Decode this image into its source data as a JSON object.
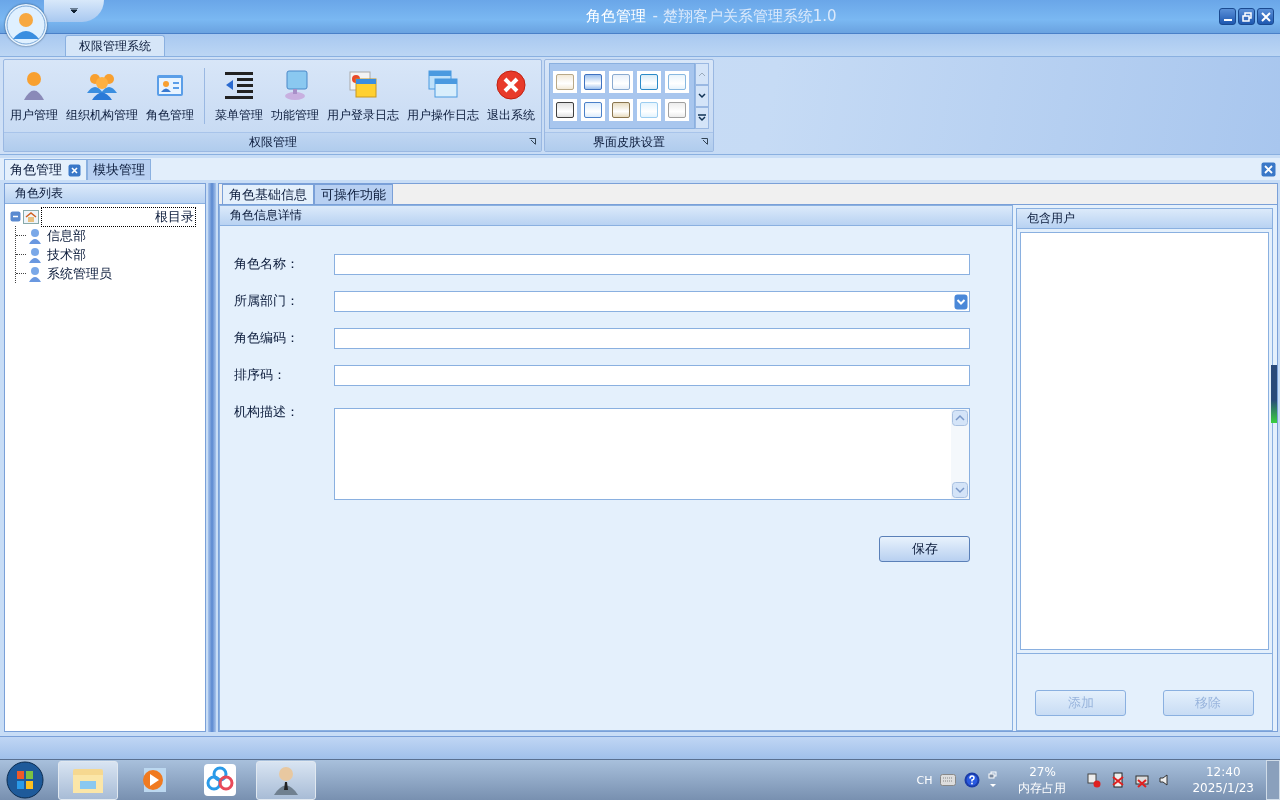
{
  "window": {
    "title": "角色管理",
    "subtitle": "- 楚翔客户关系管理系统1.0"
  },
  "ribbon": {
    "tabs": [
      {
        "label": "权限管理系统",
        "selected": true
      }
    ],
    "group": {
      "title": "权限管理",
      "buttons": [
        {
          "label": "用户管理",
          "kind": "user"
        },
        {
          "label": "组织机构管理",
          "kind": "org"
        },
        {
          "label": "角色管理",
          "kind": "role"
        },
        {
          "label": "菜单管理",
          "kind": "menu"
        },
        {
          "label": "功能管理",
          "kind": "function"
        },
        {
          "label": "用户登录日志",
          "kind": "loginlog"
        },
        {
          "label": "用户操作日志",
          "kind": "oplog"
        },
        {
          "label": "退出系统",
          "kind": "exit"
        }
      ]
    },
    "skin_group": {
      "title": "界面皮肤设置"
    }
  },
  "doc_tabs": [
    {
      "label": "角色管理",
      "selected": true,
      "closable": true
    },
    {
      "label": "模块管理",
      "selected": false,
      "closable": false
    }
  ],
  "left_panel": {
    "title": "角色列表",
    "tree": [
      {
        "label": "根目录",
        "selected": true,
        "expanded": true,
        "children": [
          {
            "label": "信息部",
            "selected": false
          },
          {
            "label": "技术部",
            "selected": false
          },
          {
            "label": "系统管理员",
            "selected": false
          }
        ]
      }
    ]
  },
  "detail_tabs": [
    {
      "label": "角色基础信息",
      "selected": true
    },
    {
      "label": "可操作功能",
      "selected": false
    }
  ],
  "form": {
    "title": "角色信息详情",
    "fields": [
      {
        "label": "角色名称：",
        "kind": "text"
      },
      {
        "label": "所属部门：",
        "kind": "select"
      },
      {
        "label": "角色编码：",
        "kind": "text"
      },
      {
        "label": "排序码：",
        "kind": "text"
      },
      {
        "label": "机构描述：",
        "kind": "textarea"
      }
    ],
    "save": "保存"
  },
  "users_panel": {
    "title": "包含用户",
    "buttons": [
      {
        "label": "添加",
        "disabled": true
      },
      {
        "label": "移除",
        "disabled": true
      }
    ]
  },
  "taskbar": {
    "apps": [
      {
        "kind": "folder",
        "selected": true
      },
      {
        "kind": "player",
        "selected": false
      },
      {
        "kind": "cloud",
        "selected": false
      },
      {
        "kind": "person",
        "selected": true
      }
    ],
    "tray": {
      "lang": "CH",
      "memory": "27%",
      "memory_label": "内存占用",
      "time": "12:40",
      "date": "2025/1/23"
    }
  }
}
